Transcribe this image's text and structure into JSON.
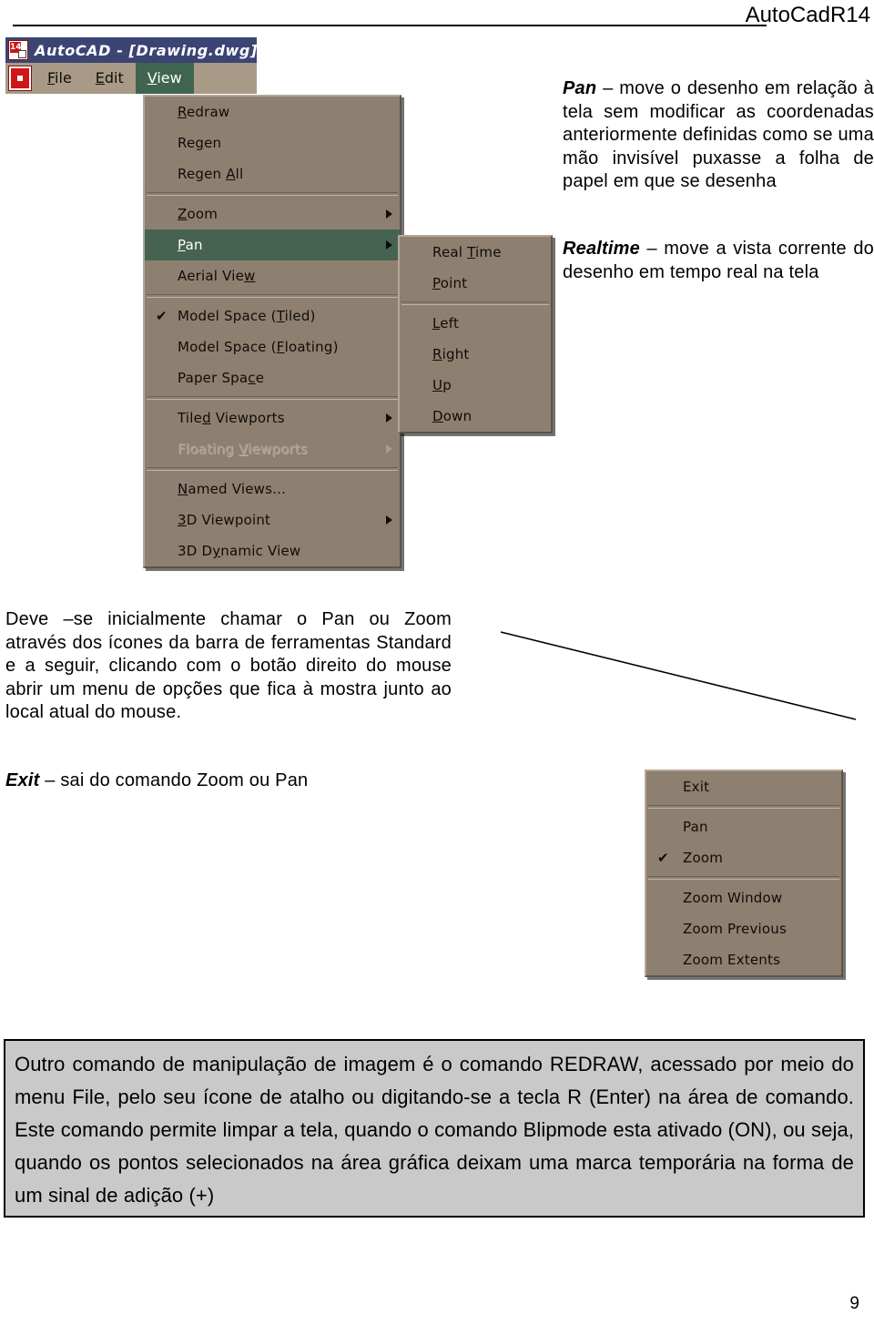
{
  "header": {
    "title": "AutoCadR14"
  },
  "acad_window": {
    "title": "AutoCAD - [Drawing.dwg]",
    "icon_badge": "14",
    "menubar": [
      {
        "label": "File",
        "mnemonic": "F",
        "active": false
      },
      {
        "label": "Edit",
        "mnemonic": "E",
        "active": false
      },
      {
        "label": "View",
        "mnemonic": "V",
        "active": true
      }
    ]
  },
  "view_menu": {
    "items": [
      {
        "label": "Redraw",
        "mnemonic": "R",
        "type": "item"
      },
      {
        "label": "Regen",
        "mnemonic": "g",
        "type": "item"
      },
      {
        "label": "Regen All",
        "mnemonic": "A",
        "type": "item"
      },
      {
        "type": "separator"
      },
      {
        "label": "Zoom",
        "mnemonic": "Z",
        "type": "item",
        "submenu": true
      },
      {
        "label": "Pan",
        "mnemonic": "P",
        "type": "item",
        "submenu": true,
        "selected": true
      },
      {
        "label": "Aerial View",
        "mnemonic": "w",
        "type": "item"
      },
      {
        "type": "separator"
      },
      {
        "label": "Model Space (Tiled)",
        "mnemonic": "T",
        "type": "item",
        "checked": true
      },
      {
        "label": "Model Space (Floating)",
        "mnemonic": "F",
        "type": "item"
      },
      {
        "label": "Paper Space",
        "mnemonic": "c",
        "type": "item"
      },
      {
        "type": "separator"
      },
      {
        "label": "Tiled Viewports",
        "mnemonic": "d",
        "type": "item",
        "submenu": true
      },
      {
        "label": "Floating Viewports",
        "mnemonic": "V",
        "type": "item",
        "submenu": true,
        "disabled": true
      },
      {
        "type": "separator"
      },
      {
        "label": "Named Views...",
        "mnemonic": "N",
        "type": "item"
      },
      {
        "label": "3D Viewpoint",
        "mnemonic": "3",
        "type": "item",
        "submenu": true
      },
      {
        "label": "3D Dynamic View",
        "mnemonic": "y",
        "type": "item"
      }
    ]
  },
  "pan_submenu": {
    "items": [
      {
        "label": "Real Time",
        "mnemonic": "T",
        "type": "item"
      },
      {
        "label": "Point",
        "mnemonic": "P",
        "type": "item"
      },
      {
        "type": "separator"
      },
      {
        "label": "Left",
        "mnemonic": "L",
        "type": "item"
      },
      {
        "label": "Right",
        "mnemonic": "R",
        "type": "item"
      },
      {
        "label": "Up",
        "mnemonic": "U",
        "type": "item"
      },
      {
        "label": "Down",
        "mnemonic": "D",
        "type": "item"
      }
    ]
  },
  "context_menu": {
    "items": [
      {
        "label": "Exit",
        "type": "item"
      },
      {
        "type": "separator"
      },
      {
        "label": "Pan",
        "type": "item"
      },
      {
        "label": "Zoom",
        "type": "item",
        "checked": true
      },
      {
        "type": "separator"
      },
      {
        "label": "Zoom Window",
        "type": "item"
      },
      {
        "label": "Zoom Previous",
        "type": "item"
      },
      {
        "label": "Zoom Extents",
        "type": "item"
      }
    ]
  },
  "paragraphs": {
    "pan_lead": "Pan",
    "pan_body": " – move o desenho em relação à tela sem modificar as coordenadas anteriormente definidas como se uma mão invisível puxasse a folha de papel em que se desenha",
    "realtime_lead": "Realtime",
    "realtime_body": " – move a vista corrente do desenho em tempo real na tela",
    "deve": "Deve –se inicialmente chamar o Pan ou Zoom através dos ícones da barra de ferramentas Standard e a seguir, clicando com o botão direito do mouse abrir um menu de opções que fica à mostra junto ao local atual do mouse.",
    "exit_lead": "Exit",
    "exit_body": " – sai do comando Zoom ou Pan"
  },
  "note_box": {
    "text": "Outro comando de manipulação de imagem é o comando REDRAW, acessado por meio do menu File, pelo seu ícone de atalho ou digitando-se a tecla R (Enter) na área de comando. Este comando permite limpar a tela, quando o comando Blipmode esta ativado (ON), ou seja, quando os pontos selecionados na área gráfica deixam uma marca temporária na forma de um sinal de adição (+)"
  },
  "page_number": "9",
  "colors": {
    "menu_background": "#8d8070",
    "menu_highlight": "#466351",
    "titlebar": "#3c4474",
    "menubar": "#a89a87",
    "note_box_fill": "#c9c9c9",
    "accent_red": "#c81414"
  }
}
